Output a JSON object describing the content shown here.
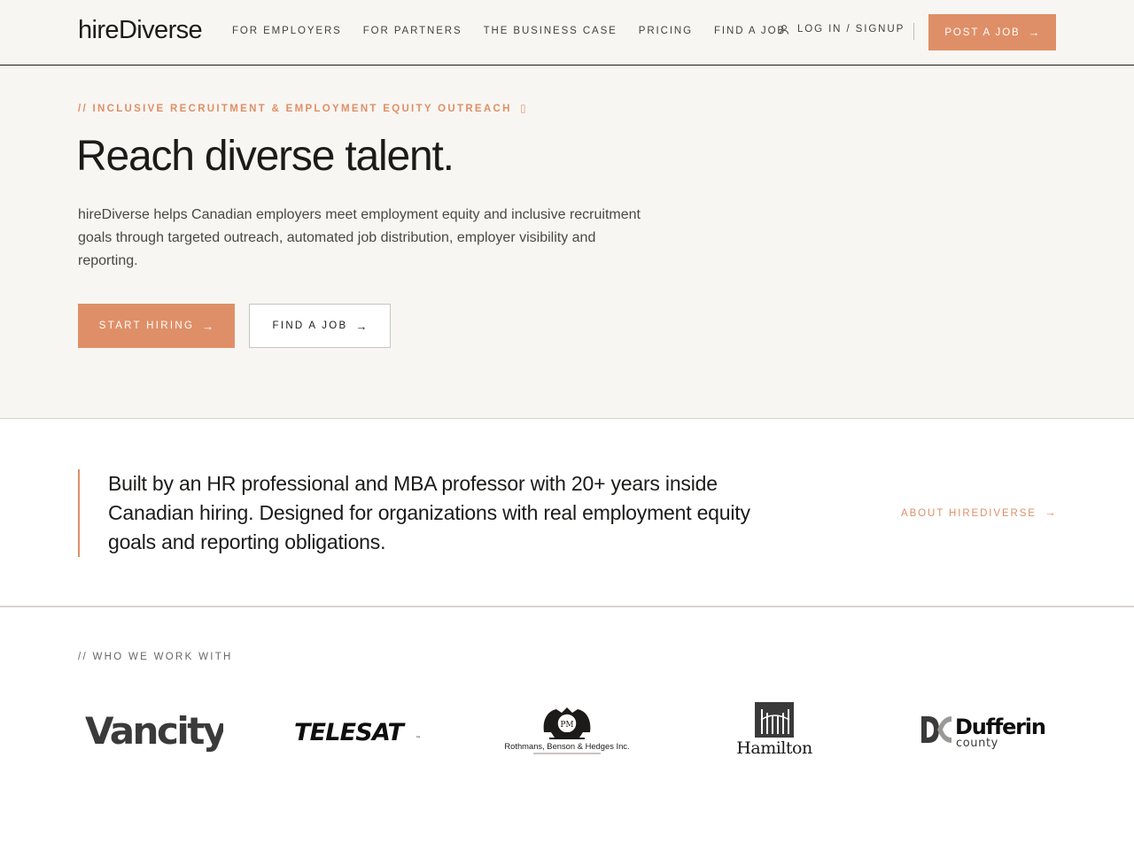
{
  "brand": {
    "name": "hireDiverse",
    "accent": "#df8f67",
    "ink": "#1c1b19",
    "cream": "#f8f6f2"
  },
  "nav": {
    "items": [
      {
        "label": "FOR EMPLOYERS"
      },
      {
        "label": "FOR PARTNERS"
      },
      {
        "label": "THE BUSINESS CASE"
      },
      {
        "label": "PRICING"
      },
      {
        "label": "FIND A JOB"
      }
    ],
    "login_label": "LOG IN / SIGNUP",
    "post_job_label": "POST A JOB",
    "login_icon": "user-icon",
    "arrow_icon": "arrow-right-icon"
  },
  "hero": {
    "eyebrow": "// INCLUSIVE RECRUITMENT & EMPLOYMENT EQUITY OUTREACH",
    "eyebrow_glyph": "▯",
    "title": "Reach diverse talent.",
    "description": "hireDiverse helps Canadian employers meet employment equity and inclusive recruitment goals through targeted outreach, automated job distribution, employer visibility and reporting.",
    "primary_cta": "START HIRING",
    "secondary_cta": "FIND A JOB",
    "arrow": "→"
  },
  "quote": {
    "text": "Built by an HR professional and MBA professor with 20+ years inside Canadian hiring. Designed for organizations with real employment equity goals and reporting obligations.",
    "link_label": "ABOUT HIREDIVERSE"
  },
  "partners": {
    "label": "// WHO WE WORK WITH",
    "logos": [
      {
        "name": "Vancity",
        "text": "Vancity"
      },
      {
        "name": "Telesat",
        "text": "TELESAT",
        "mark": "™"
      },
      {
        "name": "Rothmans, Benson & Hedges",
        "text": "Rothmans, Benson & Hedges Inc.",
        "monogram": "PM"
      },
      {
        "name": "Hamilton",
        "text": "Hamilton"
      },
      {
        "name": "Dufferin County",
        "text": "Dufferin",
        "subtext": "county"
      }
    ]
  }
}
